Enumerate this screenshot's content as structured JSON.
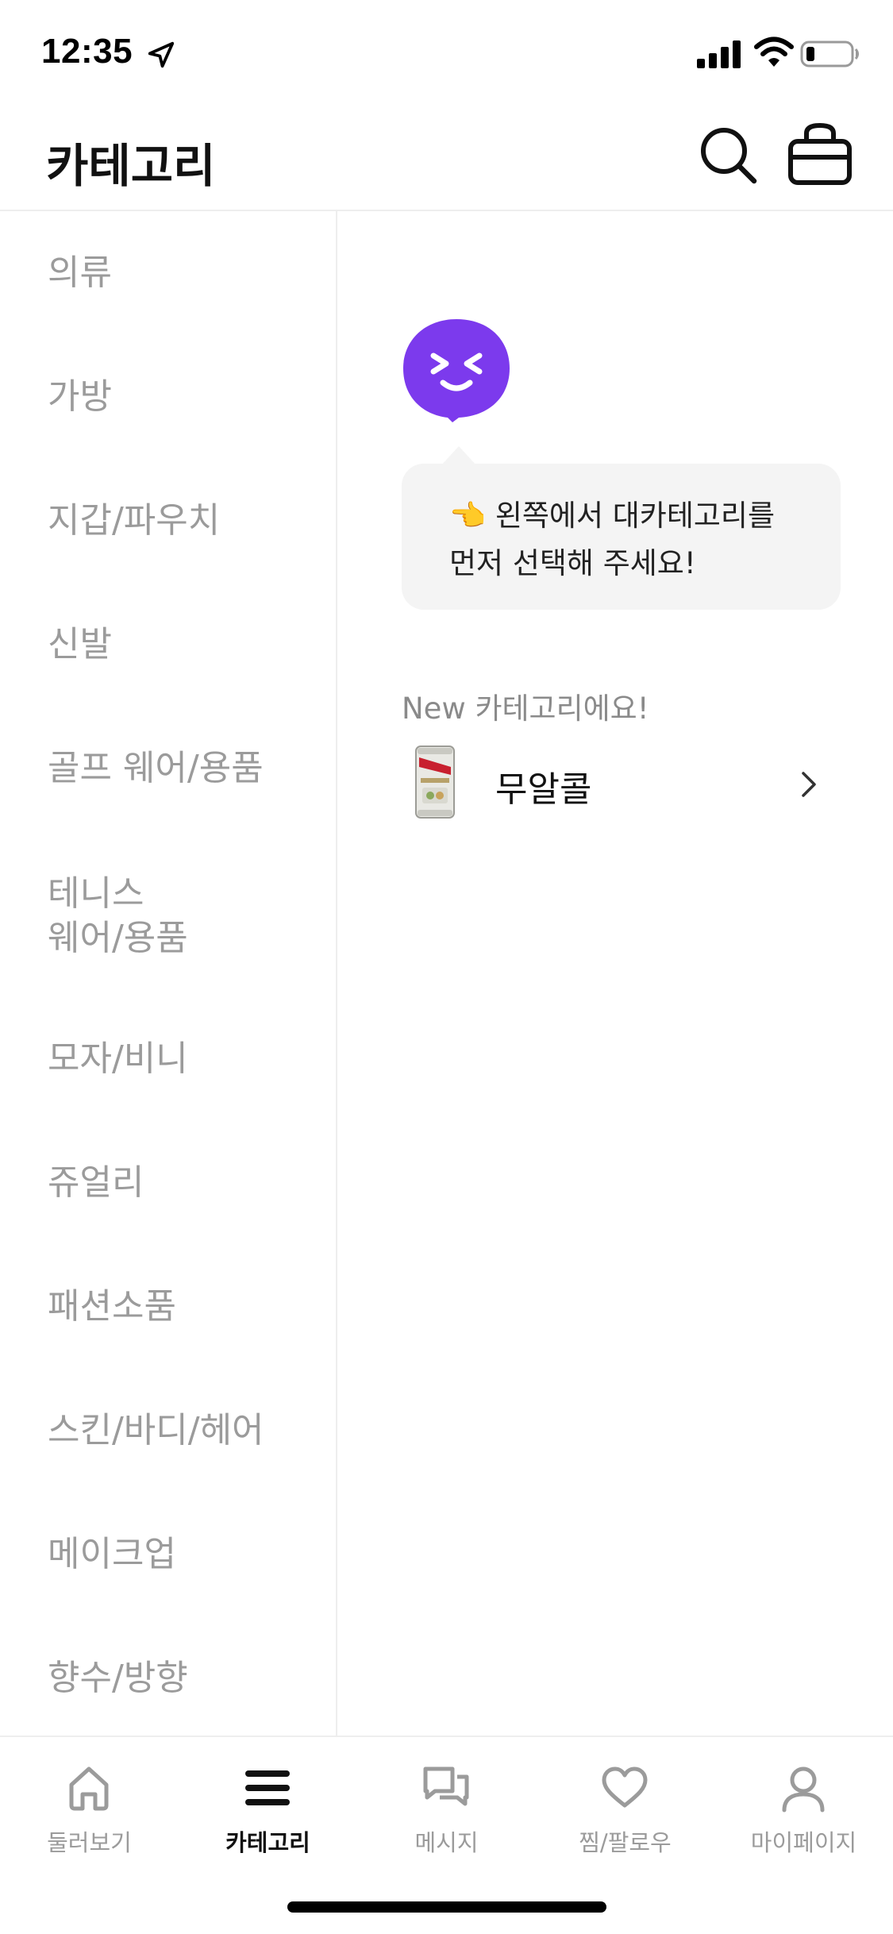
{
  "status_bar": {
    "time": "12:35",
    "icons": [
      "location-arrow-icon",
      "signal-icon",
      "wifi-icon",
      "battery-icon"
    ]
  },
  "header": {
    "title": "카테고리",
    "icons": [
      "search-icon",
      "shopping-bag-icon"
    ]
  },
  "sidebar": {
    "items": [
      {
        "label": "의류"
      },
      {
        "label": "가방"
      },
      {
        "label": "지갑/파우치"
      },
      {
        "label": "신발"
      },
      {
        "label": "골프 웨어/용품"
      },
      {
        "label": "테니스"
      },
      {
        "label": "웨어/용품"
      },
      {
        "label": "모자/비니"
      },
      {
        "label": "쥬얼리"
      },
      {
        "label": "패션소품"
      },
      {
        "label": "스킨/바디/헤어"
      },
      {
        "label": "메이크업"
      },
      {
        "label": "향수/방향"
      }
    ]
  },
  "main": {
    "mascot_icon": "smiling-face-icon",
    "bubble": {
      "line1": "👈 왼쪽에서 대카테고리를",
      "line2": "먼저 선택해 주세요!"
    },
    "new_label": "New 카테고리에요!",
    "new_category": {
      "label": "무알콜",
      "image_icon": "beer-can-icon"
    }
  },
  "bottom_nav": {
    "tabs": [
      {
        "label": "둘러보기",
        "icon": "home-icon"
      },
      {
        "label": "카테고리",
        "icon": "menu-icon",
        "active": true
      },
      {
        "label": "메시지",
        "icon": "chat-icon"
      },
      {
        "label": "찜/팔로우",
        "icon": "heart-icon"
      },
      {
        "label": "마이페이지",
        "icon": "user-icon"
      }
    ]
  },
  "colors": {
    "accent_purple": "#7c3aed",
    "text_gray": "#9b9b9b",
    "bubble_bg": "#f4f4f4"
  }
}
